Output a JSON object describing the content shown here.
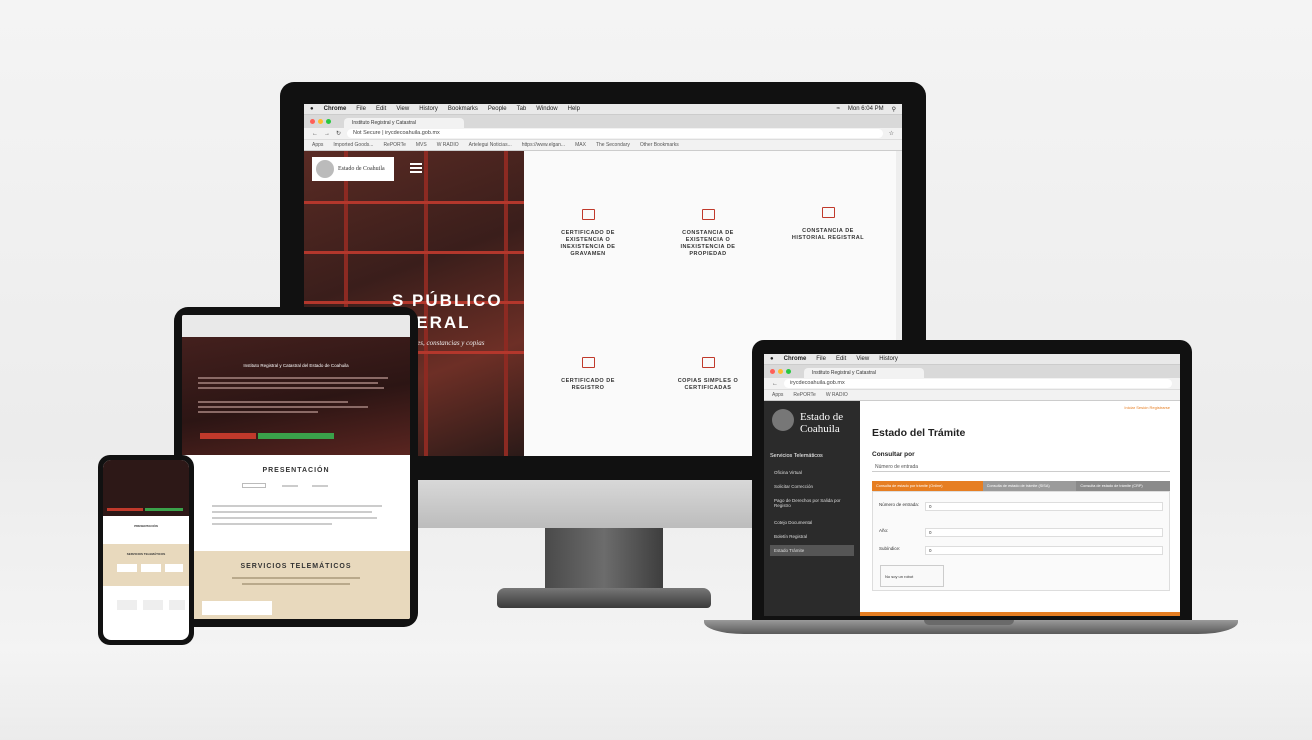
{
  "desktop": {
    "menubar": {
      "app": "Chrome",
      "items": [
        "File",
        "Edit",
        "View",
        "History",
        "Bookmarks",
        "People",
        "Tab",
        "Window",
        "Help"
      ],
      "clock": "Mon 6:04 PM"
    },
    "tab_title": "Instituto Registral y Catastral",
    "security": "Not Secure",
    "url": "irycdecoahuila.gob.mx",
    "bookmarks": [
      "Apps",
      "Imported Goods...",
      "RePORTe",
      "MVS",
      "W RADIO",
      "Artelegui Noticias...",
      "https://www.elgan...",
      "MAX",
      "The Secondary",
      "Other Bookmarks"
    ],
    "site": {
      "logo_text": "Estado de Coahuila",
      "hero_line1": "S PÚBLICO",
      "hero_line2": "NERAL",
      "hero_sub": "ámenes, constancias y copias",
      "services": [
        {
          "label": "CERTIFICADO DE EXISTENCIA O INEXISTENCIA DE GRAVAMEN"
        },
        {
          "label": "CONSTANCIA DE EXISTENCIA O INEXISTENCIA DE PROPIEDAD"
        },
        {
          "label": "CONSTANCIA DE HISTORIAL REGISTRAL"
        },
        {
          "label": "CERTIFICADO DE REGISTRO"
        },
        {
          "label": "COPIAS SIMPLES O CERTIFICADAS"
        }
      ]
    }
  },
  "tablet": {
    "title_bar": "Instituto Registral y Catastral del Estado de Coahuila",
    "presentacion": "PRESENTACIÓN",
    "servicios": "SERVICIOS TELEMÁTICOS"
  },
  "phone": {
    "presentacion": "PRESENTACIÓN",
    "servicios": "SERVICIOS TELEMÁTICOS"
  },
  "laptop": {
    "logo": "Estado de Coahuila",
    "section": "Servicios Telemáticos",
    "nav": [
      "Oficina Virtual",
      "Solicitar Corrección",
      "Pago de Derechos por Salida por Registro",
      "Cotejo Documental",
      "Boletín Registral",
      "Estado Trámite"
    ],
    "heading": "Estado del Trámite",
    "consultar": "Consultar por",
    "select_value": "Número de entrada",
    "tabs": [
      {
        "label": "Consulta de estado por trámite (Online)",
        "color": "#e67e22"
      },
      {
        "label": "Consulta de estado de trámite (SISA)",
        "color": "#9b9b9b"
      },
      {
        "label": "Consulta de estado de trámite (CRP)",
        "color": "#9b9b9b"
      }
    ],
    "fields": [
      {
        "label": "Número de entrada:",
        "value": "0"
      },
      {
        "label": "Año:",
        "value": "0"
      },
      {
        "label": "Subíndice:",
        "value": "0"
      }
    ],
    "captcha": "No soy un robot",
    "top_links": "Iniciar Sesión  Registrarse"
  },
  "colors": {
    "accent": "#c0392b",
    "orange": "#e67e22",
    "green": "#3aa14a",
    "beige": "#e8d9bd"
  }
}
